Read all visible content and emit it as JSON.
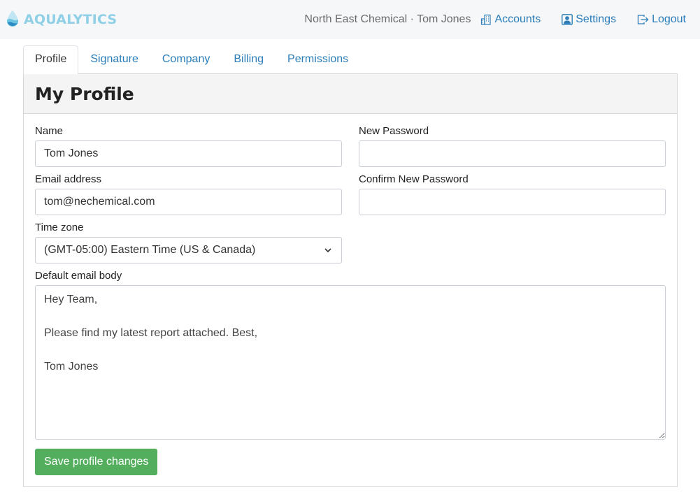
{
  "header": {
    "brand": "AQUALYTICS",
    "context": "North East Chemical · Tom Jones",
    "links": [
      {
        "label": "Accounts",
        "icon": "building-icon"
      },
      {
        "label": "Settings",
        "icon": "user-square-icon"
      },
      {
        "label": "Logout",
        "icon": "logout-icon"
      }
    ]
  },
  "tabs": [
    {
      "label": "Profile",
      "active": true
    },
    {
      "label": "Signature",
      "active": false
    },
    {
      "label": "Company",
      "active": false
    },
    {
      "label": "Billing",
      "active": false
    },
    {
      "label": "Permissions",
      "active": false
    }
  ],
  "page": {
    "title": "My Profile"
  },
  "form": {
    "name": {
      "label": "Name",
      "value": "Tom Jones"
    },
    "email": {
      "label": "Email address",
      "value": "tom@nechemical.com"
    },
    "timezone": {
      "label": "Time zone",
      "value": "(GMT-05:00) Eastern Time (US & Canada)"
    },
    "new_password": {
      "label": "New Password",
      "value": ""
    },
    "confirm_password": {
      "label": "Confirm New Password",
      "value": ""
    },
    "email_body": {
      "label": "Default email body",
      "value": "Hey Team,\n\nPlease find my latest report attached. Best,\n\nTom Jones"
    },
    "save_label": "Save profile changes"
  },
  "colors": {
    "brand": "#8fd0e6",
    "link": "#2a7db8",
    "save_button": "#53ae5d"
  }
}
